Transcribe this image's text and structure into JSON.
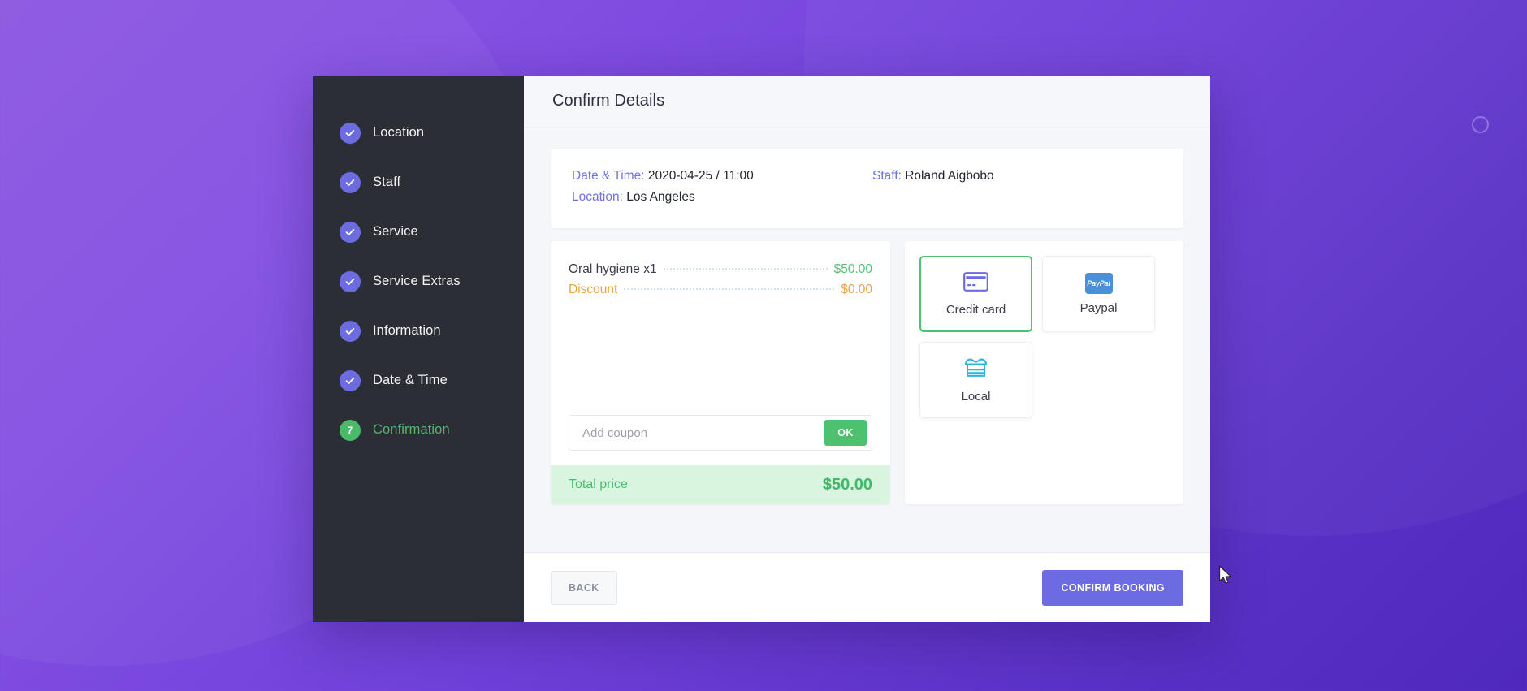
{
  "theme": {
    "accent_purple": "#6c6ce0",
    "accent_green": "#4ec16e",
    "discount_orange": "#eda23a",
    "sidebar_bg": "#2b2e34",
    "page_bg_from": "#8b56e0",
    "page_bg_to": "#4f28bd"
  },
  "sidebar": {
    "steps": [
      {
        "label": "Location",
        "state": "done",
        "marker": "check"
      },
      {
        "label": "Staff",
        "state": "done",
        "marker": "check"
      },
      {
        "label": "Service",
        "state": "done",
        "marker": "check"
      },
      {
        "label": "Service Extras",
        "state": "done",
        "marker": "check"
      },
      {
        "label": "Information",
        "state": "done",
        "marker": "check"
      },
      {
        "label": "Date & Time",
        "state": "done",
        "marker": "check"
      },
      {
        "label": "Confirmation",
        "state": "current",
        "marker": "7"
      }
    ]
  },
  "header": {
    "title": "Confirm Details"
  },
  "info": {
    "datetime_label": "Date & Time:",
    "datetime_value": "2020-04-25 / 11:00",
    "location_label": "Location:",
    "location_value": "Los Angeles",
    "staff_label": "Staff:",
    "staff_value": "Roland Aigbobo"
  },
  "cart": {
    "lines": [
      {
        "name": "Oral hygiene x1",
        "amount": "$50.00",
        "kind": "item"
      },
      {
        "name": "Discount",
        "amount": "$0.00",
        "kind": "discount"
      }
    ],
    "coupon_placeholder": "Add coupon",
    "coupon_value": "",
    "coupon_button": "OK",
    "total_label": "Total price",
    "total_amount": "$50.00"
  },
  "payments": {
    "methods": [
      {
        "label": "Credit card",
        "icon": "credit-card-icon",
        "selected": true
      },
      {
        "label": "Paypal",
        "icon": "paypal-icon",
        "selected": false
      },
      {
        "label": "Local",
        "icon": "storefront-icon",
        "selected": false
      }
    ],
    "paypal_wordmark": "PayPal"
  },
  "footer": {
    "back_label": "BACK",
    "confirm_label": "CONFIRM BOOKING"
  }
}
